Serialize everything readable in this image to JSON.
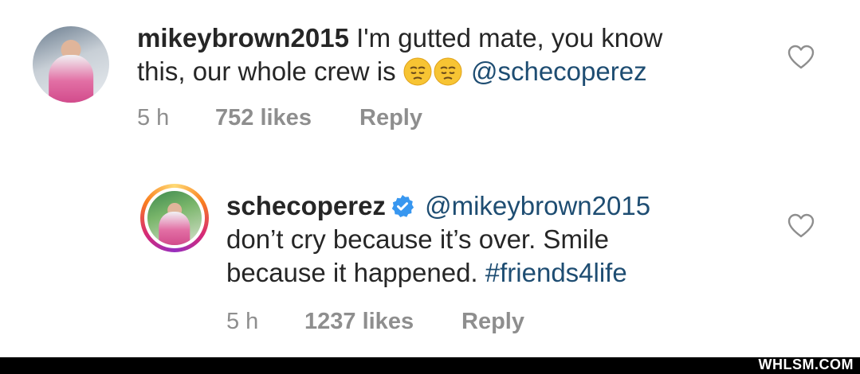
{
  "comments": [
    {
      "username": "mikeybrown2015",
      "text_before": " I'm gutted mate,  you know",
      "text_line2": "this, our whole crew is ",
      "emojis": [
        "pensive-face-emoji",
        "pensive-face-emoji"
      ],
      "mention": "@schecoperez",
      "time": "5 h",
      "likes": "752 likes",
      "reply": "Reply"
    },
    {
      "username": "schecoperez",
      "verified": true,
      "mention": "@mikeybrown2015",
      "text_line2": "don’t cry because it’s over. Smile",
      "text_line3": "because it happened. ",
      "hashtag": "#friends4life",
      "time": "5 h",
      "likes": "1237 likes",
      "reply": "Reply"
    }
  ],
  "watermark": "WHLSM.COM",
  "colors": {
    "link": "#1e4d72",
    "meta": "#8e8e8e",
    "verified": "#3897f0"
  }
}
